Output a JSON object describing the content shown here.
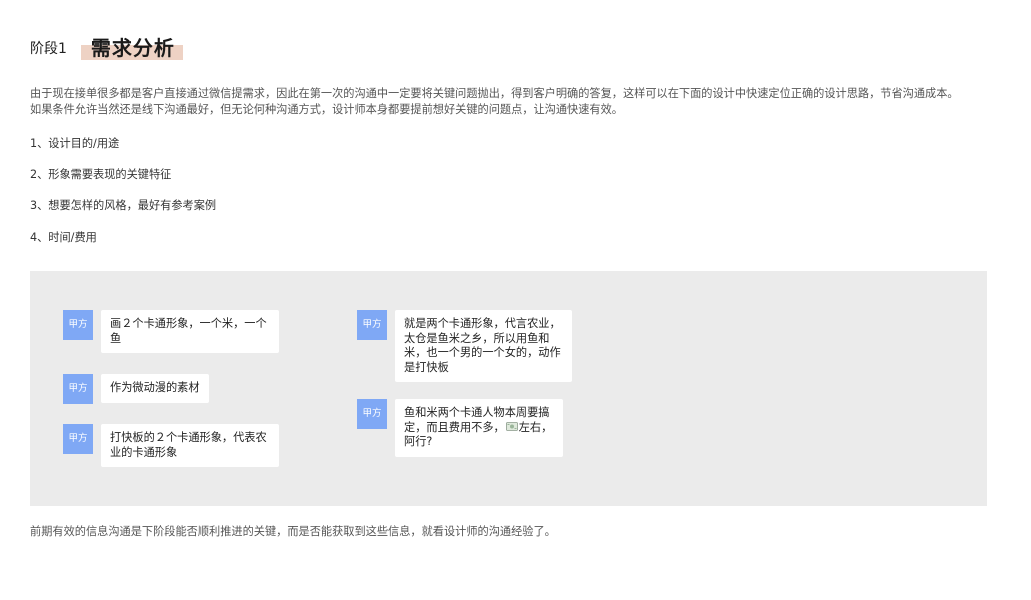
{
  "header": {
    "stage": "阶段1",
    "title": "需求分析"
  },
  "intro": {
    "line1": "由于现在接单很多都是客户直接通过微信提需求，因此在第一次的沟通中一定要将关键问题抛出，得到客户明确的答复，这样可以在下面的设计中快速定位正确的设计思路，节省沟通成本。",
    "line2": "如果条件允许当然还是线下沟通最好，但无论何种沟通方式，设计师本身都要提前想好关键的问题点，让沟通快速有效。"
  },
  "list": [
    "1、设计目的/用途",
    "2、形象需要表现的关键特征",
    "3、想要怎样的风格，最好有参考案例",
    "4、时间/费用"
  ],
  "chat": {
    "left": [
      {
        "avatar": "甲方",
        "text": "画２个卡通形象，一个米，一个鱼"
      },
      {
        "avatar": "甲方",
        "text": "作为微动漫的素材"
      },
      {
        "avatar": "甲方",
        "text": "打快板的２个卡通形象，代表农业的卡通形象"
      }
    ],
    "right": [
      {
        "avatar": "甲方",
        "text": "就是两个卡通形象，代言农业，太仓是鱼米之乡，所以用鱼和米，也一个男的一个女的，动作是打快板"
      },
      {
        "avatar": "甲方",
        "text_before": "鱼和米两个卡通人物本周要搞定，而且费用不多，",
        "emoji": "money-emoji",
        "text_after": "左右，阿行?"
      }
    ]
  },
  "footer": "前期有效的信息沟通是下阶段能否顺利推进的关键，而是否能获取到这些信息，就看设计师的沟通经验了。",
  "colors": {
    "avatar_bg": "#7fa8f5",
    "title_highlight": "#eed2c4",
    "chat_bg": "#ebebeb"
  }
}
